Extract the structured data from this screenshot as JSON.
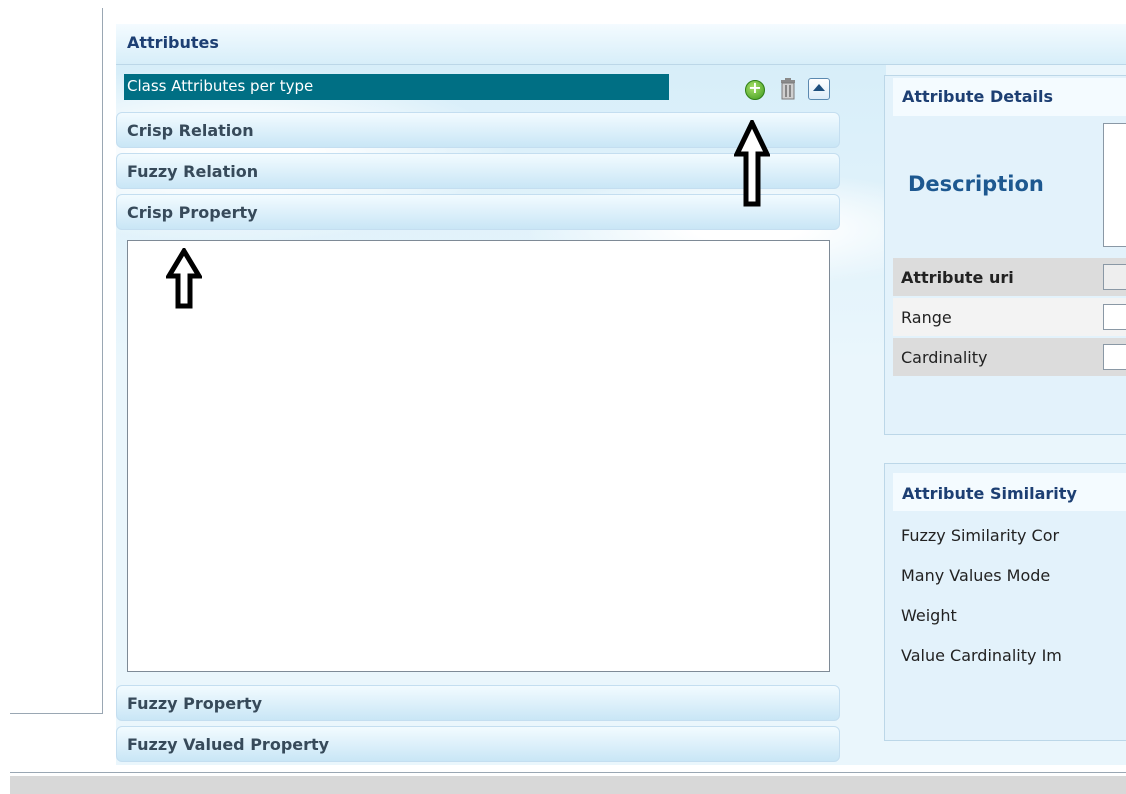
{
  "panel": {
    "title": "Attributes"
  },
  "class_attributes": {
    "selected_label": "Class Attributes per type",
    "icons": [
      "add-icon",
      "trash-icon",
      "collapse-up-icon"
    ]
  },
  "accordion": [
    {
      "label": "Crisp Relation"
    },
    {
      "label": "Fuzzy Relation"
    },
    {
      "label": "Crisp Property"
    },
    {
      "label": "Fuzzy Property"
    },
    {
      "label": "Fuzzy Valued Property"
    }
  ],
  "details": {
    "title": "Attribute Details",
    "description_label": "Description",
    "rows": [
      {
        "label": "Attribute uri"
      },
      {
        "label": "Range"
      },
      {
        "label": "Cardinality"
      }
    ]
  },
  "similarity": {
    "title": "Attribute Similarity",
    "rows": [
      {
        "label": "Fuzzy Similarity Cor"
      },
      {
        "label": "Many Values Mode"
      },
      {
        "label": "Weight"
      },
      {
        "label": "Value Cardinality Im"
      }
    ]
  },
  "colors": {
    "selection": "#006f84",
    "title": "#1d3f73",
    "accordion_text": "#374a5a"
  }
}
